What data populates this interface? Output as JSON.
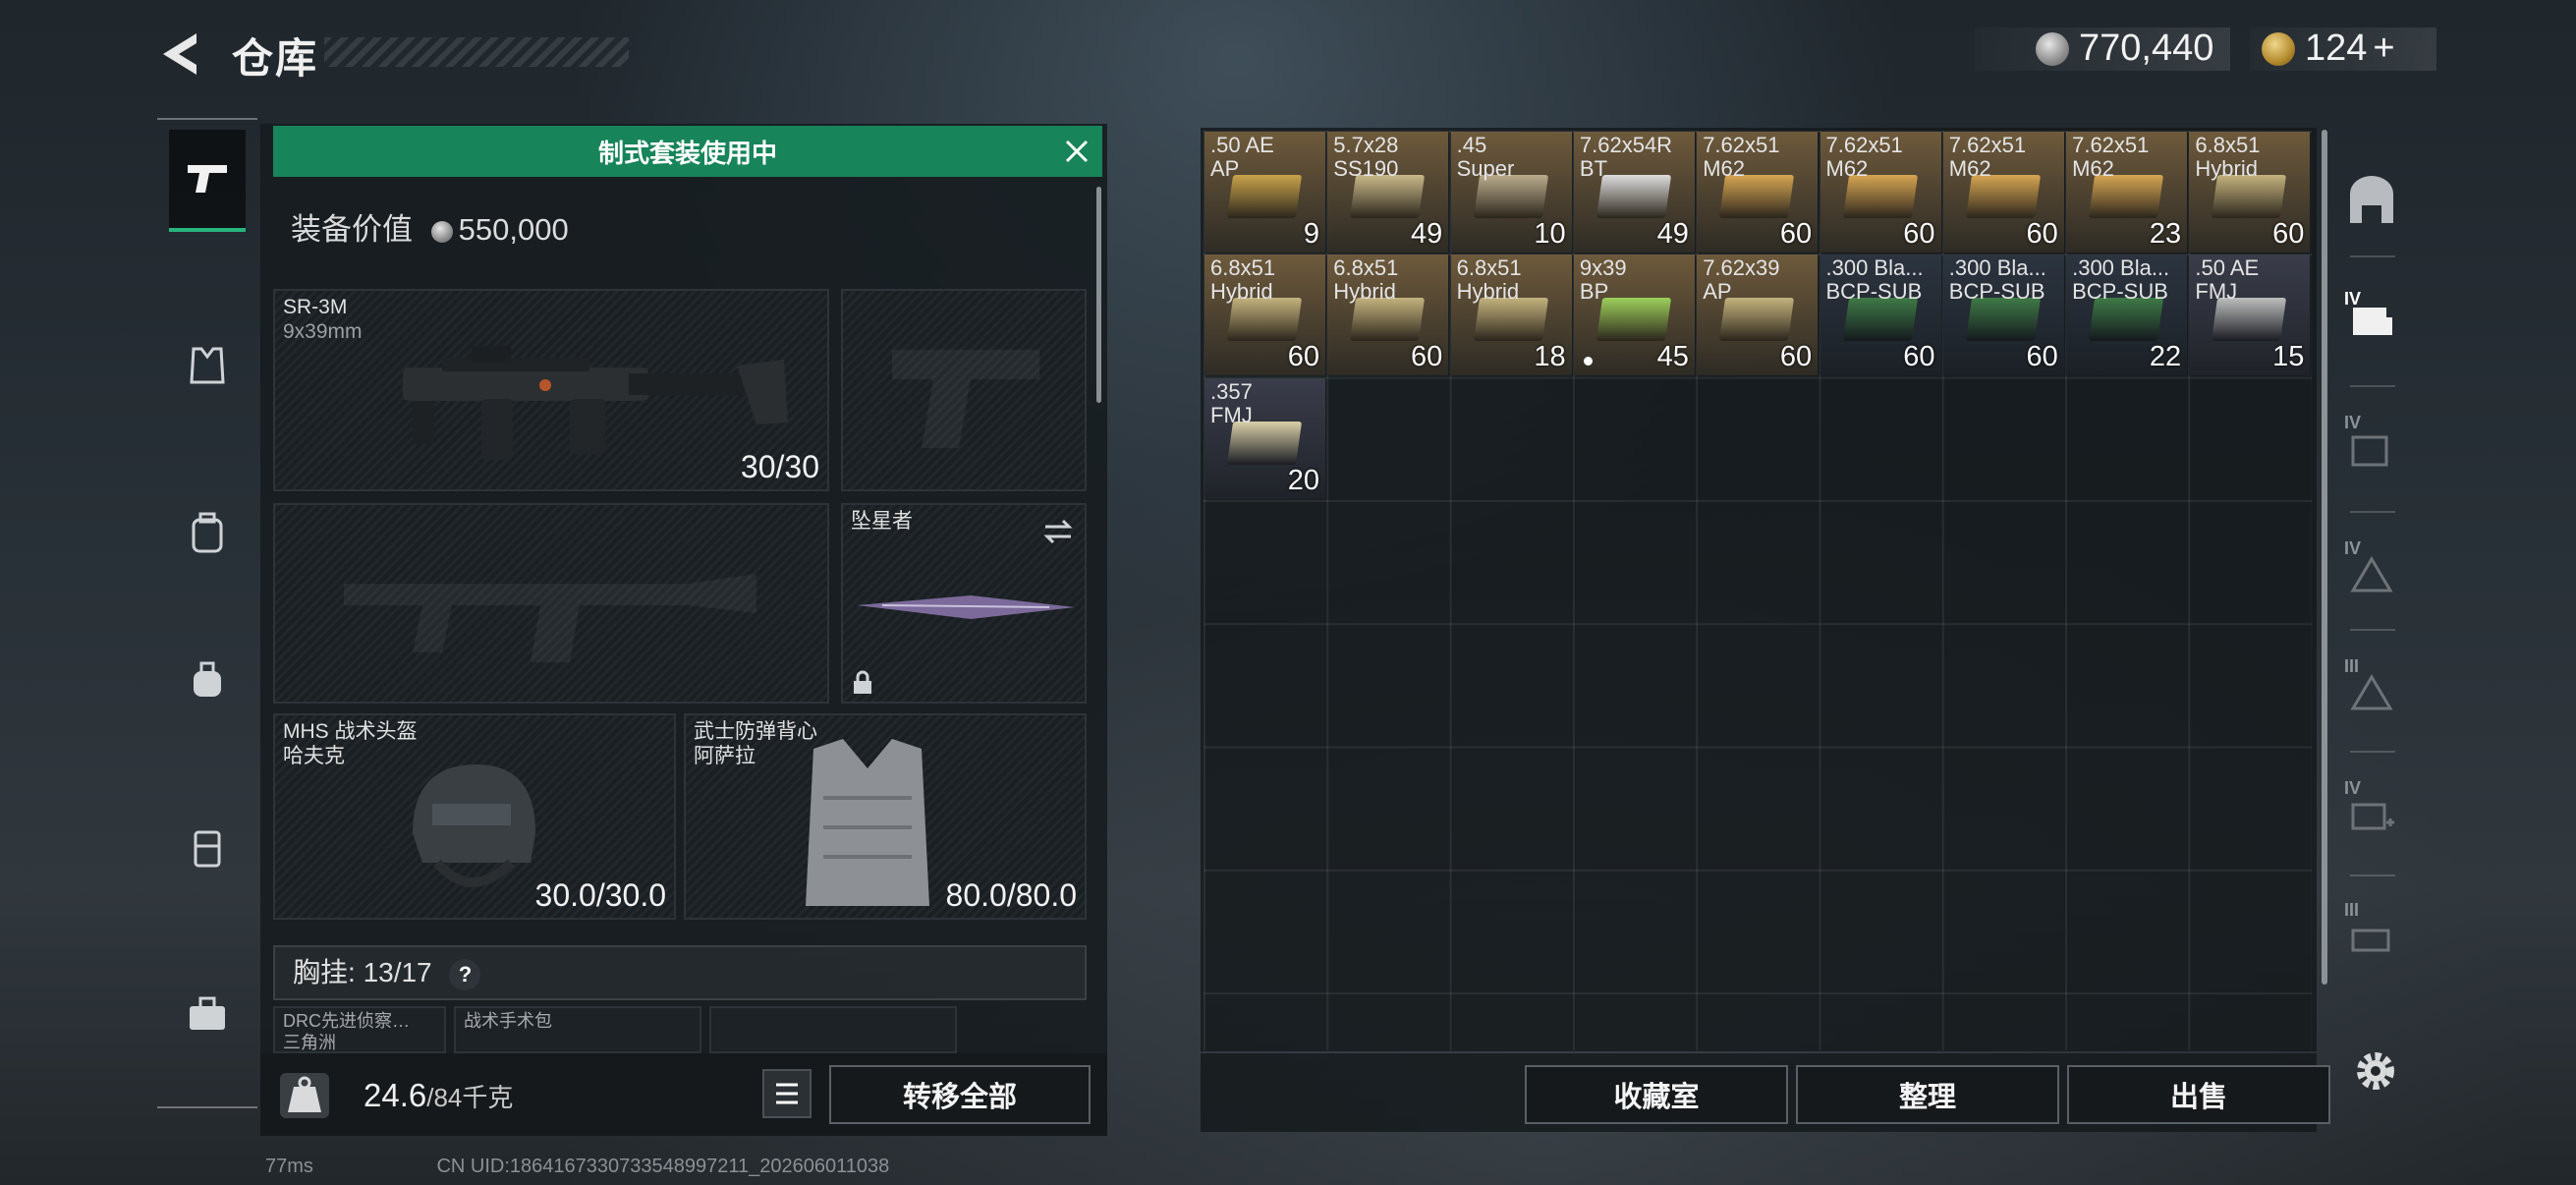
{
  "header": {
    "title": "仓库",
    "currency": [
      {
        "icon": "silver-coin-icon",
        "value": "770,440"
      },
      {
        "icon": "gold-triangle-coin-icon",
        "value": "124",
        "plus": "+"
      }
    ]
  },
  "loadout": {
    "banner": "制式套装使用中",
    "value_label": "装备价值",
    "value": "550,000",
    "primary": {
      "name": "SR-3M",
      "caliber": "9x39mm",
      "ammo": "30/30"
    },
    "melee": {
      "name": "坠星者"
    },
    "helmet": {
      "name": "MHS 战术头盔",
      "sub": "哈夫克",
      "durability": "30.0/30.0"
    },
    "armor": {
      "name": "武士防弹背心",
      "sub": "阿萨拉",
      "durability": "80.0/80.0"
    },
    "chest": {
      "label": "胸挂:",
      "capacity": "13/17",
      "help": "?"
    },
    "mini_slots": [
      "DRC先进侦察…",
      "三角洲",
      "战术手术包"
    ],
    "weight": "24.6",
    "weight_max": "/84千克",
    "transfer_all": "转移全部"
  },
  "stash": {
    "items": [
      {
        "cal": ".50 AE\nAP",
        "count": "9",
        "color": "#6e5a3c",
        "box": "#c7a24a"
      },
      {
        "cal": "5.7x28\nSS190",
        "count": "49",
        "color": "#6e5a3c",
        "box": "#c9b889"
      },
      {
        "cal": ".45\nSuper",
        "count": "10",
        "color": "#6e5a3c",
        "box": "#b8ab8c"
      },
      {
        "cal": "7.62x54R\nBT",
        "count": "49",
        "color": "#6e5a3c",
        "box": "#dcdcdc"
      },
      {
        "cal": "7.62x51\nM62",
        "count": "60",
        "color": "#6e5a3c",
        "box": "#d6a552"
      },
      {
        "cal": "7.62x51\nM62",
        "count": "60",
        "color": "#6e5a3c",
        "box": "#d6a552"
      },
      {
        "cal": "7.62x51\nM62",
        "count": "60",
        "color": "#6e5a3c",
        "box": "#d6a552"
      },
      {
        "cal": "7.62x51\nM62",
        "count": "23",
        "color": "#6e5a3c",
        "box": "#d6a552"
      },
      {
        "cal": "6.8x51\nHybrid",
        "count": "60",
        "color": "#6e5a3c",
        "box": "#c3b27e"
      },
      {
        "cal": "6.8x51\nHybrid",
        "count": "60",
        "color": "#6e5a3c",
        "box": "#c3b27e"
      },
      {
        "cal": "6.8x51\nHybrid",
        "count": "60",
        "color": "#6e5a3c",
        "box": "#c3b27e"
      },
      {
        "cal": "6.8x51\nHybrid",
        "count": "18",
        "color": "#6e5a3c",
        "box": "#c3b27e"
      },
      {
        "cal": "9x39\nBP",
        "count": "45",
        "color": "#6e5a3c",
        "box": "#9ccf5a",
        "dot": true
      },
      {
        "cal": "7.62x39\nAP",
        "count": "60",
        "color": "#6e5a3c",
        "box": "#c3b27e"
      },
      {
        "cal": ".300 Bla...\nBCP-SUB",
        "count": "60",
        "color": "#2c3440",
        "box": "#3e7a46"
      },
      {
        "cal": ".300 Bla...\nBCP-SUB",
        "count": "60",
        "color": "#2c3440",
        "box": "#3e7a46"
      },
      {
        "cal": ".300 Bla...\nBCP-SUB",
        "count": "22",
        "color": "#2c3440",
        "box": "#3e7a46"
      },
      {
        "cal": ".50 AE\nFMJ",
        "count": "15",
        "color": "#3a3d4a",
        "box": "#bdbdbd"
      },
      {
        "cal": ".357\nFMJ",
        "count": "20",
        "color": "#3a3d4a",
        "box": "#d9cfa8"
      }
    ],
    "collect": "收藏室",
    "sort": "整理",
    "sell": "出售"
  },
  "right_nav": [
    "armory-tab-icon",
    "IV",
    "IV",
    "IV",
    "III",
    "IV",
    "III"
  ],
  "status_bar": {
    "ping": "77ms",
    "uid": "CN UID:1864167330733548997211_202606011038"
  }
}
